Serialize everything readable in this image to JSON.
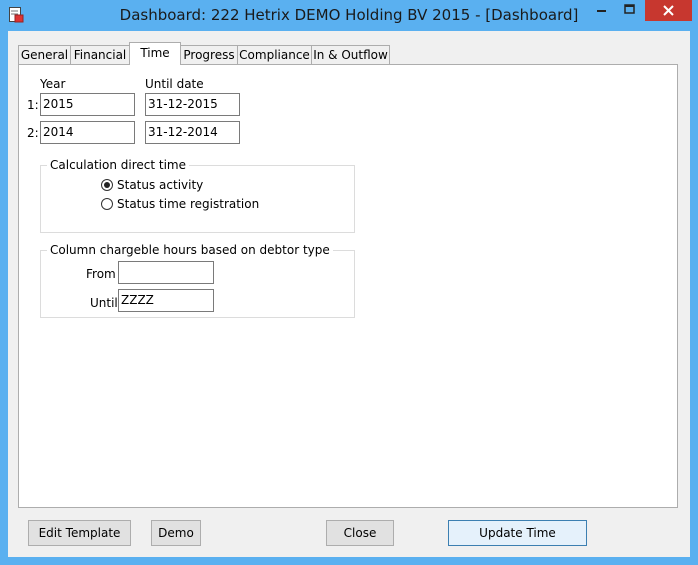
{
  "window": {
    "title": "Dashboard: 222 Hetrix DEMO Holding BV 2015 - [Dashboard]"
  },
  "tabs": [
    {
      "label": "General"
    },
    {
      "label": "Financial"
    },
    {
      "label": "Time",
      "active": true
    },
    {
      "label": "Progress"
    },
    {
      "label": "Compliance"
    },
    {
      "label": "In & Outflow"
    }
  ],
  "time": {
    "year_label": "Year",
    "until_label": "Until date",
    "rows": [
      {
        "index": "1:",
        "year": "2015",
        "until": "31-12-2015"
      },
      {
        "index": "2:",
        "year": "2014",
        "until": "31-12-2014"
      }
    ],
    "calc": {
      "title": "Calculation direct time",
      "options": [
        {
          "label": "Status activity",
          "checked": true
        },
        {
          "label": "Status time registration",
          "checked": false
        }
      ]
    },
    "chargeable": {
      "title": "Column chargeble hours based on debtor type",
      "from_label": "From",
      "from_value": "",
      "until_label": "Until",
      "until_value": "ZZZZ"
    }
  },
  "buttons": {
    "edit_template": "Edit Template",
    "demo": "Demo",
    "close": "Close",
    "update_time": "Update Time"
  }
}
